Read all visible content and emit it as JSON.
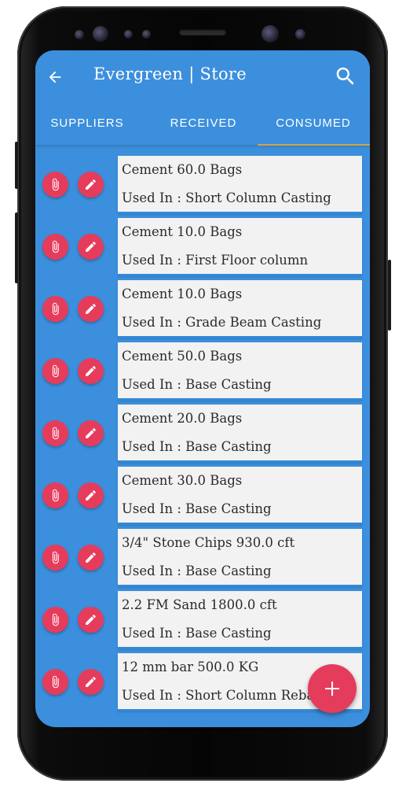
{
  "app": {
    "title": "Evergreen | Store",
    "back_icon": "arrow-left-icon",
    "search_icon": "search-icon"
  },
  "tabs": [
    {
      "label": "SUPPLIERS",
      "active": false
    },
    {
      "label": "RECEIVED",
      "active": false
    },
    {
      "label": "CONSUMED",
      "active": true
    }
  ],
  "colors": {
    "primary": "#3c8fdc",
    "accent": "#e63c5c",
    "tab_indicator": "#d0a441",
    "card_bg": "#f2f2f2"
  },
  "items": [
    {
      "title": "Cement 60.0 Bags",
      "used_in": "Used In : Short Column Casting"
    },
    {
      "title": "Cement 10.0 Bags",
      "used_in": "Used In : First Floor column"
    },
    {
      "title": "Cement 10.0 Bags",
      "used_in": "Used In : Grade Beam Casting"
    },
    {
      "title": "Cement 50.0 Bags",
      "used_in": "Used In : Base Casting"
    },
    {
      "title": "Cement 20.0 Bags",
      "used_in": "Used In : Base Casting"
    },
    {
      "title": "Cement 30.0 Bags",
      "used_in": "Used In : Base Casting"
    },
    {
      "title": "3/4\" Stone Chips 930.0 cft",
      "used_in": "Used In : Base Casting"
    },
    {
      "title": "2.2 FM Sand 1800.0 cft",
      "used_in": "Used In : Base Casting"
    },
    {
      "title": "12 mm bar 500.0 KG",
      "used_in": "Used In : Short Column Rebar"
    }
  ],
  "row_actions": {
    "attach_icon": "paperclip-icon",
    "edit_icon": "pencil-icon"
  },
  "fab": {
    "icon": "plus-icon"
  }
}
